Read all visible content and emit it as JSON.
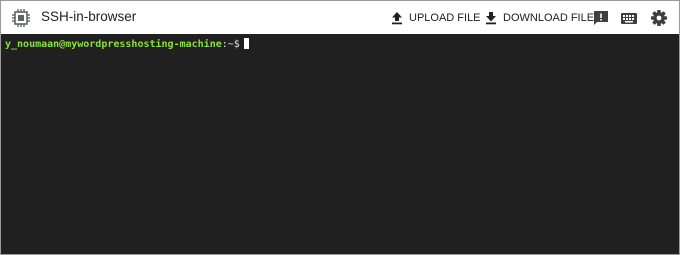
{
  "app": {
    "title": "SSH-in-browser",
    "icon": "chip-icon"
  },
  "toolbar": {
    "upload_label": "UPLOAD FILE",
    "upload_icon": "upload-icon",
    "download_label": "DOWNLOAD FILE",
    "download_icon": "download-icon",
    "feedback_icon": "feedback-icon",
    "keyboard_icon": "keyboard-icon",
    "settings_icon": "gear-icon"
  },
  "terminal": {
    "prompt_user_host": "y_noumaan@mywordpresshosting-machine",
    "prompt_path": ":~$",
    "background_color": "#202020",
    "prompt_color": "#8ae234"
  }
}
